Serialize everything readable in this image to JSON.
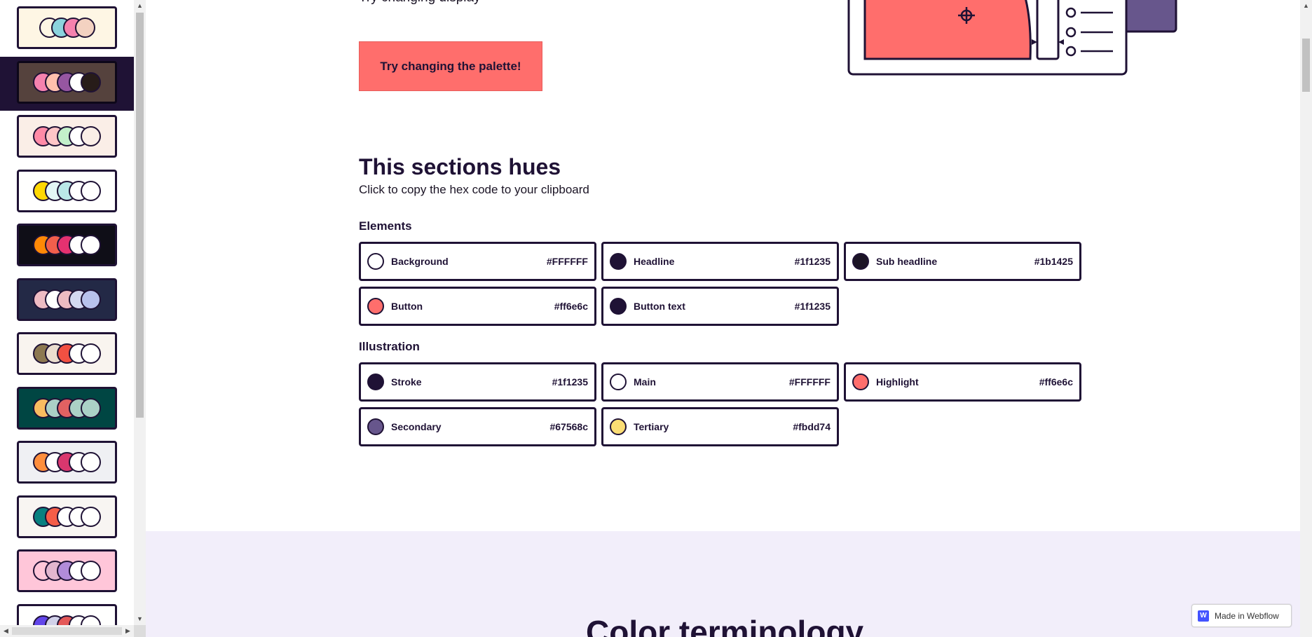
{
  "sidebar": {
    "palettes": [
      {
        "bg": "#fef6e4",
        "colors": [
          "#fef6e4",
          "#8bd3dd",
          "#f582ae",
          "#f3d2c1"
        ]
      },
      {
        "bg": "#55423d",
        "colors": [
          "#f582ae",
          "#ffc0ad",
          "#9656a1",
          "#fffffe",
          "#271c19"
        ],
        "active": true
      },
      {
        "bg": "#faeee7",
        "colors": [
          "#ff8ba7",
          "#ffc6c7",
          "#c3f0ca",
          "#ffffff",
          "#faeee7"
        ]
      },
      {
        "bg": "#fffffe",
        "colors": [
          "#ffd803",
          "#e3f6f5",
          "#bae8e8",
          "#fffffe",
          "#fffffe"
        ]
      },
      {
        "bg": "#0f0e17",
        "colors": [
          "#ff8906",
          "#f25f4c",
          "#e53170",
          "#fffffe",
          "#fffffe"
        ]
      },
      {
        "bg": "#232946",
        "colors": [
          "#eebbc3",
          "#fffffe",
          "#eebbc3",
          "#d4d8f0",
          "#b8c1ec"
        ]
      },
      {
        "bg": "#f9f4ef",
        "colors": [
          "#8c7851",
          "#eaddcf",
          "#f25042",
          "#fffffe",
          "#fffffe"
        ]
      },
      {
        "bg": "#004643",
        "colors": [
          "#f9bc60",
          "#abd1c6",
          "#e16162",
          "#abd1c6",
          "#abd1c6"
        ]
      },
      {
        "bg": "#eff0f3",
        "colors": [
          "#ff8e3c",
          "#fffffe",
          "#d9376e",
          "#fffffe",
          "#fffffe"
        ]
      },
      {
        "bg": "#f8f5f2",
        "colors": [
          "#078080",
          "#f45d48",
          "#fffffe",
          "#fffffe",
          "#fffffe"
        ]
      },
      {
        "bg": "#ffc6d9",
        "colors": [
          "#ffc6d9",
          "#e2b6cf",
          "#b28cd9",
          "#fffffe",
          "#fffffe"
        ]
      },
      {
        "bg": "#fffffe",
        "colors": [
          "#6246ea",
          "#d1d1e9",
          "#e45858",
          "#fffffe",
          "#fffffe"
        ]
      }
    ]
  },
  "hero": {
    "cut_text": "Try changing display",
    "cta_label": "Try changing the palette!"
  },
  "section": {
    "title": "This sections hues",
    "subtitle": "Click to copy the hex code to your clipboard",
    "elements_label": "Elements",
    "illustration_label": "Illustration",
    "elements": [
      {
        "name": "Background",
        "hex": "#FFFFFF",
        "color": "#ffffff"
      },
      {
        "name": "Headline",
        "hex": "#1f1235",
        "color": "#1f1235"
      },
      {
        "name": "Sub headline",
        "hex": "#1b1425",
        "color": "#1b1425"
      },
      {
        "name": "Button",
        "hex": "#ff6e6c",
        "color": "#ff6e6c"
      },
      {
        "name": "Button text",
        "hex": "#1f1235",
        "color": "#1f1235"
      }
    ],
    "illustration": [
      {
        "name": "Stroke",
        "hex": "#1f1235",
        "color": "#1f1235"
      },
      {
        "name": "Main",
        "hex": "#FFFFFF",
        "color": "#ffffff"
      },
      {
        "name": "Highlight",
        "hex": "#ff6e6c",
        "color": "#ff6e6c"
      },
      {
        "name": "Secondary",
        "hex": "#67568c",
        "color": "#67568c"
      },
      {
        "name": "Tertiary",
        "hex": "#fbdd74",
        "color": "#fbdd74"
      }
    ]
  },
  "terminology": {
    "title": "Color terminology"
  },
  "badge": {
    "label": "Made in Webflow",
    "logo": "W"
  },
  "colors": {
    "accent": "#ff6e6c",
    "ink": "#1f1235",
    "lavender_bg": "#f2eefa"
  }
}
